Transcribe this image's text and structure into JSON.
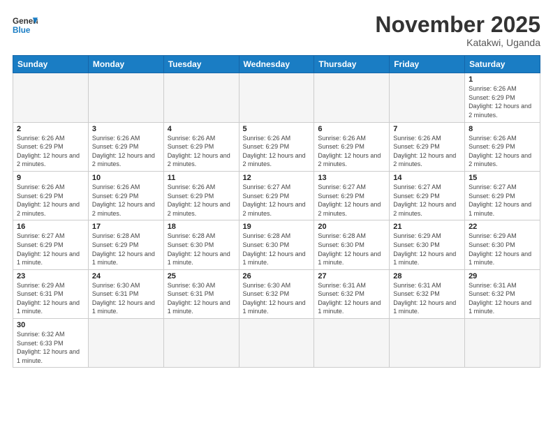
{
  "header": {
    "logo_general": "General",
    "logo_blue": "Blue",
    "month_title": "November 2025",
    "subtitle": "Katakwi, Uganda"
  },
  "weekdays": [
    "Sunday",
    "Monday",
    "Tuesday",
    "Wednesday",
    "Thursday",
    "Friday",
    "Saturday"
  ],
  "rows": [
    [
      {
        "day": "",
        "info": ""
      },
      {
        "day": "",
        "info": ""
      },
      {
        "day": "",
        "info": ""
      },
      {
        "day": "",
        "info": ""
      },
      {
        "day": "",
        "info": ""
      },
      {
        "day": "",
        "info": ""
      },
      {
        "day": "1",
        "info": "Sunrise: 6:26 AM\nSunset: 6:29 PM\nDaylight: 12 hours and 2 minutes."
      }
    ],
    [
      {
        "day": "2",
        "info": "Sunrise: 6:26 AM\nSunset: 6:29 PM\nDaylight: 12 hours and 2 minutes."
      },
      {
        "day": "3",
        "info": "Sunrise: 6:26 AM\nSunset: 6:29 PM\nDaylight: 12 hours and 2 minutes."
      },
      {
        "day": "4",
        "info": "Sunrise: 6:26 AM\nSunset: 6:29 PM\nDaylight: 12 hours and 2 minutes."
      },
      {
        "day": "5",
        "info": "Sunrise: 6:26 AM\nSunset: 6:29 PM\nDaylight: 12 hours and 2 minutes."
      },
      {
        "day": "6",
        "info": "Sunrise: 6:26 AM\nSunset: 6:29 PM\nDaylight: 12 hours and 2 minutes."
      },
      {
        "day": "7",
        "info": "Sunrise: 6:26 AM\nSunset: 6:29 PM\nDaylight: 12 hours and 2 minutes."
      },
      {
        "day": "8",
        "info": "Sunrise: 6:26 AM\nSunset: 6:29 PM\nDaylight: 12 hours and 2 minutes."
      }
    ],
    [
      {
        "day": "9",
        "info": "Sunrise: 6:26 AM\nSunset: 6:29 PM\nDaylight: 12 hours and 2 minutes."
      },
      {
        "day": "10",
        "info": "Sunrise: 6:26 AM\nSunset: 6:29 PM\nDaylight: 12 hours and 2 minutes."
      },
      {
        "day": "11",
        "info": "Sunrise: 6:26 AM\nSunset: 6:29 PM\nDaylight: 12 hours and 2 minutes."
      },
      {
        "day": "12",
        "info": "Sunrise: 6:27 AM\nSunset: 6:29 PM\nDaylight: 12 hours and 2 minutes."
      },
      {
        "day": "13",
        "info": "Sunrise: 6:27 AM\nSunset: 6:29 PM\nDaylight: 12 hours and 2 minutes."
      },
      {
        "day": "14",
        "info": "Sunrise: 6:27 AM\nSunset: 6:29 PM\nDaylight: 12 hours and 2 minutes."
      },
      {
        "day": "15",
        "info": "Sunrise: 6:27 AM\nSunset: 6:29 PM\nDaylight: 12 hours and 1 minute."
      }
    ],
    [
      {
        "day": "16",
        "info": "Sunrise: 6:27 AM\nSunset: 6:29 PM\nDaylight: 12 hours and 1 minute."
      },
      {
        "day": "17",
        "info": "Sunrise: 6:28 AM\nSunset: 6:29 PM\nDaylight: 12 hours and 1 minute."
      },
      {
        "day": "18",
        "info": "Sunrise: 6:28 AM\nSunset: 6:30 PM\nDaylight: 12 hours and 1 minute."
      },
      {
        "day": "19",
        "info": "Sunrise: 6:28 AM\nSunset: 6:30 PM\nDaylight: 12 hours and 1 minute."
      },
      {
        "day": "20",
        "info": "Sunrise: 6:28 AM\nSunset: 6:30 PM\nDaylight: 12 hours and 1 minute."
      },
      {
        "day": "21",
        "info": "Sunrise: 6:29 AM\nSunset: 6:30 PM\nDaylight: 12 hours and 1 minute."
      },
      {
        "day": "22",
        "info": "Sunrise: 6:29 AM\nSunset: 6:30 PM\nDaylight: 12 hours and 1 minute."
      }
    ],
    [
      {
        "day": "23",
        "info": "Sunrise: 6:29 AM\nSunset: 6:31 PM\nDaylight: 12 hours and 1 minute."
      },
      {
        "day": "24",
        "info": "Sunrise: 6:30 AM\nSunset: 6:31 PM\nDaylight: 12 hours and 1 minute."
      },
      {
        "day": "25",
        "info": "Sunrise: 6:30 AM\nSunset: 6:31 PM\nDaylight: 12 hours and 1 minute."
      },
      {
        "day": "26",
        "info": "Sunrise: 6:30 AM\nSunset: 6:32 PM\nDaylight: 12 hours and 1 minute."
      },
      {
        "day": "27",
        "info": "Sunrise: 6:31 AM\nSunset: 6:32 PM\nDaylight: 12 hours and 1 minute."
      },
      {
        "day": "28",
        "info": "Sunrise: 6:31 AM\nSunset: 6:32 PM\nDaylight: 12 hours and 1 minute."
      },
      {
        "day": "29",
        "info": "Sunrise: 6:31 AM\nSunset: 6:32 PM\nDaylight: 12 hours and 1 minute."
      }
    ],
    [
      {
        "day": "30",
        "info": "Sunrise: 6:32 AM\nSunset: 6:33 PM\nDaylight: 12 hours and 1 minute."
      },
      {
        "day": "",
        "info": ""
      },
      {
        "day": "",
        "info": ""
      },
      {
        "day": "",
        "info": ""
      },
      {
        "day": "",
        "info": ""
      },
      {
        "day": "",
        "info": ""
      },
      {
        "day": "",
        "info": ""
      }
    ]
  ]
}
